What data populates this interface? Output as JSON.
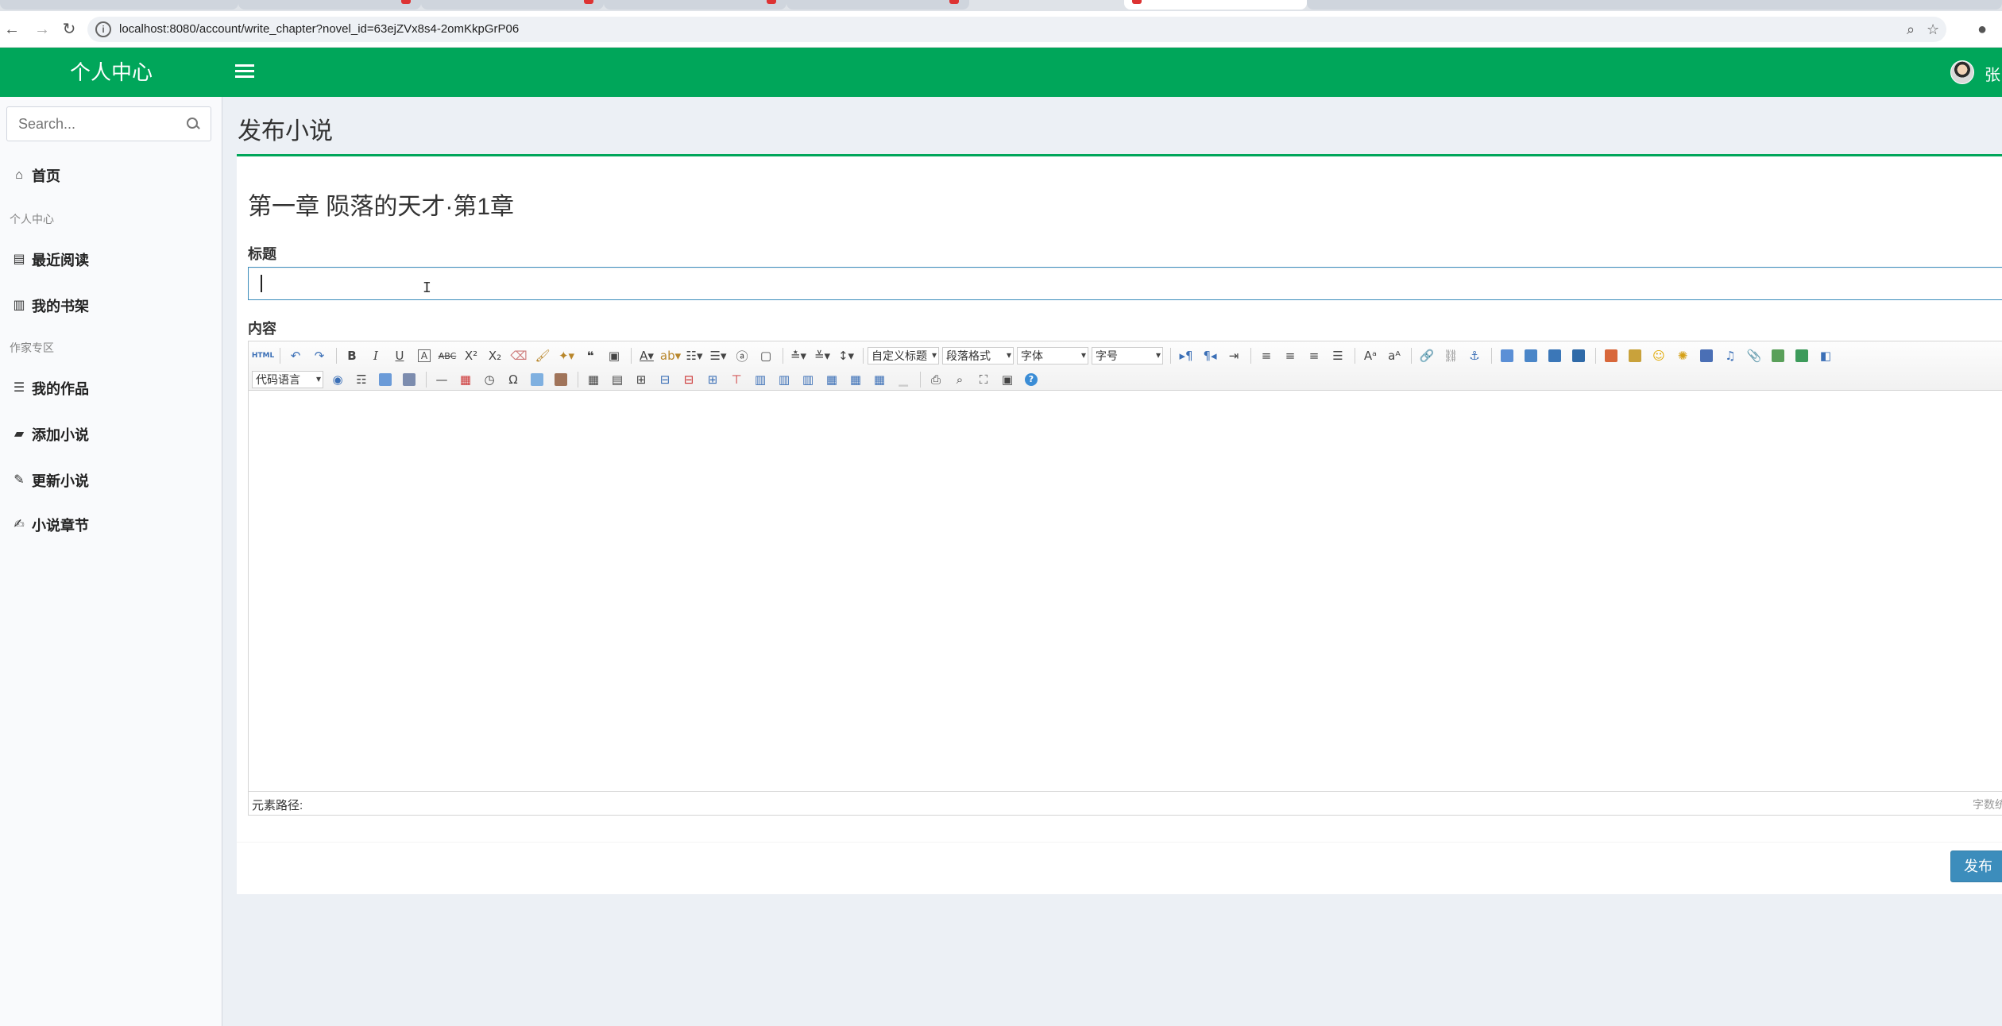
{
  "browser": {
    "url": "localhost:8080/account/write_chapter?novel_id=63ejZVx8s4-2omKkpGrP06"
  },
  "header": {
    "logo": "个人中心",
    "username": "张"
  },
  "sidebar": {
    "search_placeholder": "Search...",
    "items": [
      {
        "label": "首页",
        "icon": "home-icon"
      },
      {
        "header": "个人中心"
      },
      {
        "label": "最近阅读",
        "icon": "columns-icon"
      },
      {
        "label": "我的书架",
        "icon": "book-icon"
      },
      {
        "header": "作家专区"
      },
      {
        "label": "我的作品",
        "icon": "list-icon"
      },
      {
        "label": "添加小说",
        "icon": "suitcase-icon"
      },
      {
        "label": "更新小说",
        "icon": "pencil-icon"
      },
      {
        "label": "小说章节",
        "icon": "edit-icon"
      }
    ]
  },
  "main": {
    "page_title": "发布小说",
    "chapter_title": "第一章 陨落的天才·第1章",
    "title_label": "标题",
    "title_value": "",
    "content_label": "内容",
    "editor": {
      "selects": {
        "custom_heading": "自定义标题",
        "paragraph": "段落格式",
        "font": "字体",
        "size": "字号",
        "code_lang": "代码语言"
      },
      "footer_path": "元素路径:",
      "footer_count": "字数统计"
    },
    "publish_button": "发布"
  }
}
